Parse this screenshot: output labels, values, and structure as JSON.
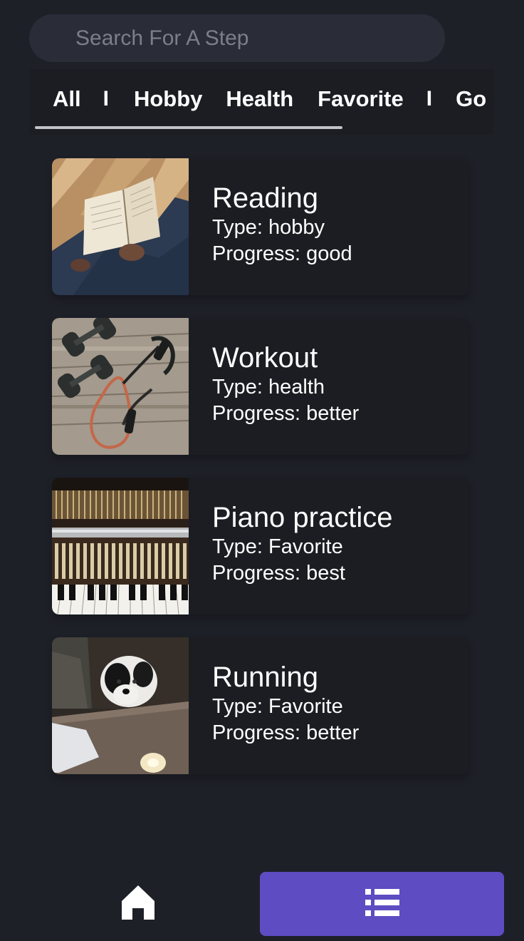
{
  "search": {
    "placeholder": "Search For A Step",
    "value": ""
  },
  "tabs": {
    "items": [
      {
        "label": "All",
        "selected": true
      },
      {
        "label": "Hobby",
        "selected": false
      },
      {
        "label": "Health",
        "selected": false
      },
      {
        "label": "Favorite",
        "selected": false
      },
      {
        "label": "Go",
        "selected": false
      }
    ],
    "separator": "I"
  },
  "steps": [
    {
      "title": "Reading",
      "type_line": "Type: hobby",
      "progress_line": "Progress: good",
      "image": "reading-photo"
    },
    {
      "title": "Workout",
      "type_line": "Type: health",
      "progress_line": "Progress: better",
      "image": "workout-photo"
    },
    {
      "title": "Piano practice",
      "type_line": "Type: Favorite",
      "progress_line": "Progress: best",
      "image": "piano-photo"
    },
    {
      "title": "Running",
      "type_line": "Type: Favorite",
      "progress_line": "Progress: better",
      "image": "dog-photo"
    }
  ],
  "bottom_nav": {
    "home_icon": "home-icon",
    "list_icon": "list-icon",
    "active": "list"
  },
  "colors": {
    "background": "#1e2028",
    "accent": "#5d4cc2",
    "search_bg": "#2a2d38",
    "card_bg": "#1b1d22"
  }
}
